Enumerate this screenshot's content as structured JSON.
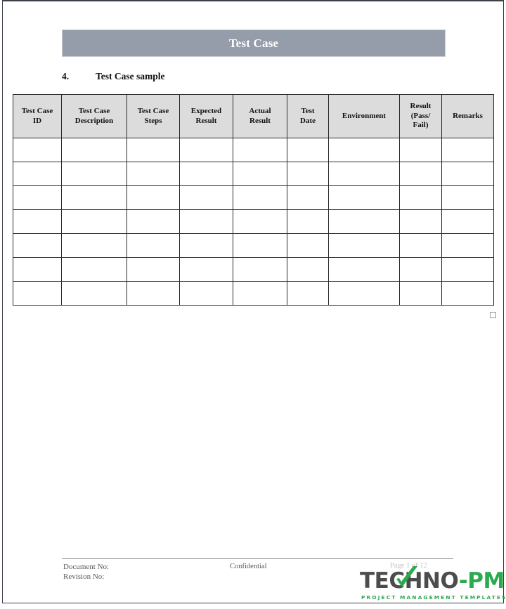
{
  "document": {
    "banner_title": "Test Case",
    "section": {
      "number": "4.",
      "title": "Test Case sample"
    }
  },
  "table": {
    "headers": [
      "Test Case ID",
      "Test Case Description",
      "Test Case Steps",
      "Expected Result",
      "Actual Result",
      "Test Date",
      "Environment",
      "Result (Pass/ Fail)",
      "Remarks"
    ],
    "header_lines": [
      [
        "Test Case",
        "ID"
      ],
      [
        "Test Case",
        "Description"
      ],
      [
        "Test Case",
        "Steps"
      ],
      [
        "Expected",
        "Result"
      ],
      [
        "Actual",
        "Result"
      ],
      [
        "Test",
        "Date"
      ],
      [
        "Environment"
      ],
      [
        "Result",
        "(Pass/",
        "Fail)"
      ],
      [
        "Remarks"
      ]
    ],
    "row_count": 7,
    "rows": [
      [
        "",
        "",
        "",
        "",
        "",
        "",
        "",
        "",
        ""
      ],
      [
        "",
        "",
        "",
        "",
        "",
        "",
        "",
        "",
        ""
      ],
      [
        "",
        "",
        "",
        "",
        "",
        "",
        "",
        "",
        ""
      ],
      [
        "",
        "",
        "",
        "",
        "",
        "",
        "",
        "",
        ""
      ],
      [
        "",
        "",
        "",
        "",
        "",
        "",
        "",
        "",
        ""
      ],
      [
        "",
        "",
        "",
        "",
        "",
        "",
        "",
        "",
        ""
      ],
      [
        "",
        "",
        "",
        "",
        "",
        "",
        "",
        "",
        ""
      ]
    ]
  },
  "footer": {
    "document_no_label": "Document No:",
    "revision_no_label": "Revision No:",
    "confidential_label": "Confidential",
    "page_number": "Page 1 of 12"
  },
  "logo": {
    "text_dark": "TECH",
    "text_dark_2": "NO",
    "text_dash": "-",
    "text_green": "PM",
    "tagline": "PROJECT MANAGEMENT TEMPLATES"
  },
  "colors": {
    "banner_background": "#959caa",
    "banner_text": "#ffffff",
    "table_header_background": "#dcdcdc",
    "table_border": "#2b2b2b",
    "footer_text": "#595959",
    "logo_green": "#2aab4e",
    "logo_dark": "#4c4c4c",
    "page_border": "#3b4049"
  }
}
